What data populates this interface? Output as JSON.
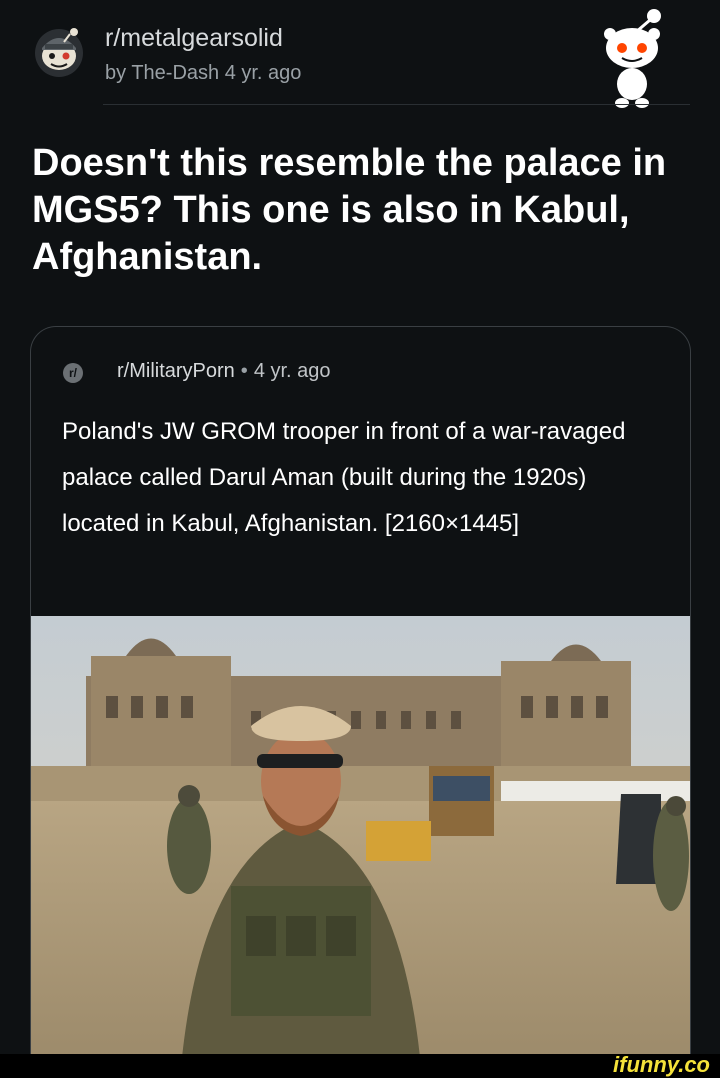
{
  "header": {
    "subreddit": "r/metalgearsolid",
    "byline": "by The-Dash 4 yr. ago",
    "avatar_icon": "subreddit-avatar-icon",
    "mascot_icon": "snoo-mascot-icon"
  },
  "post": {
    "title": "Doesn't this resemble the palace in MGS5? This one is also in Kabul, Afghanistan."
  },
  "crosspost": {
    "icon": "crosspost-icon",
    "icon_glyph": "r/",
    "subreddit": "r/MilitaryPorn",
    "separator": "•",
    "age": "4 yr. ago",
    "title": "Poland's JW GROM trooper in front of a war-ravaged palace called Darul Aman (built during the 1920s) located in Kabul, Afghanistan. [2160×1445]"
  },
  "watermark": "ifunny.co",
  "colors": {
    "background": "#0e1113",
    "text": "#ffffff",
    "muted": "#9aa1a6",
    "watermark": "#f5e23a"
  }
}
